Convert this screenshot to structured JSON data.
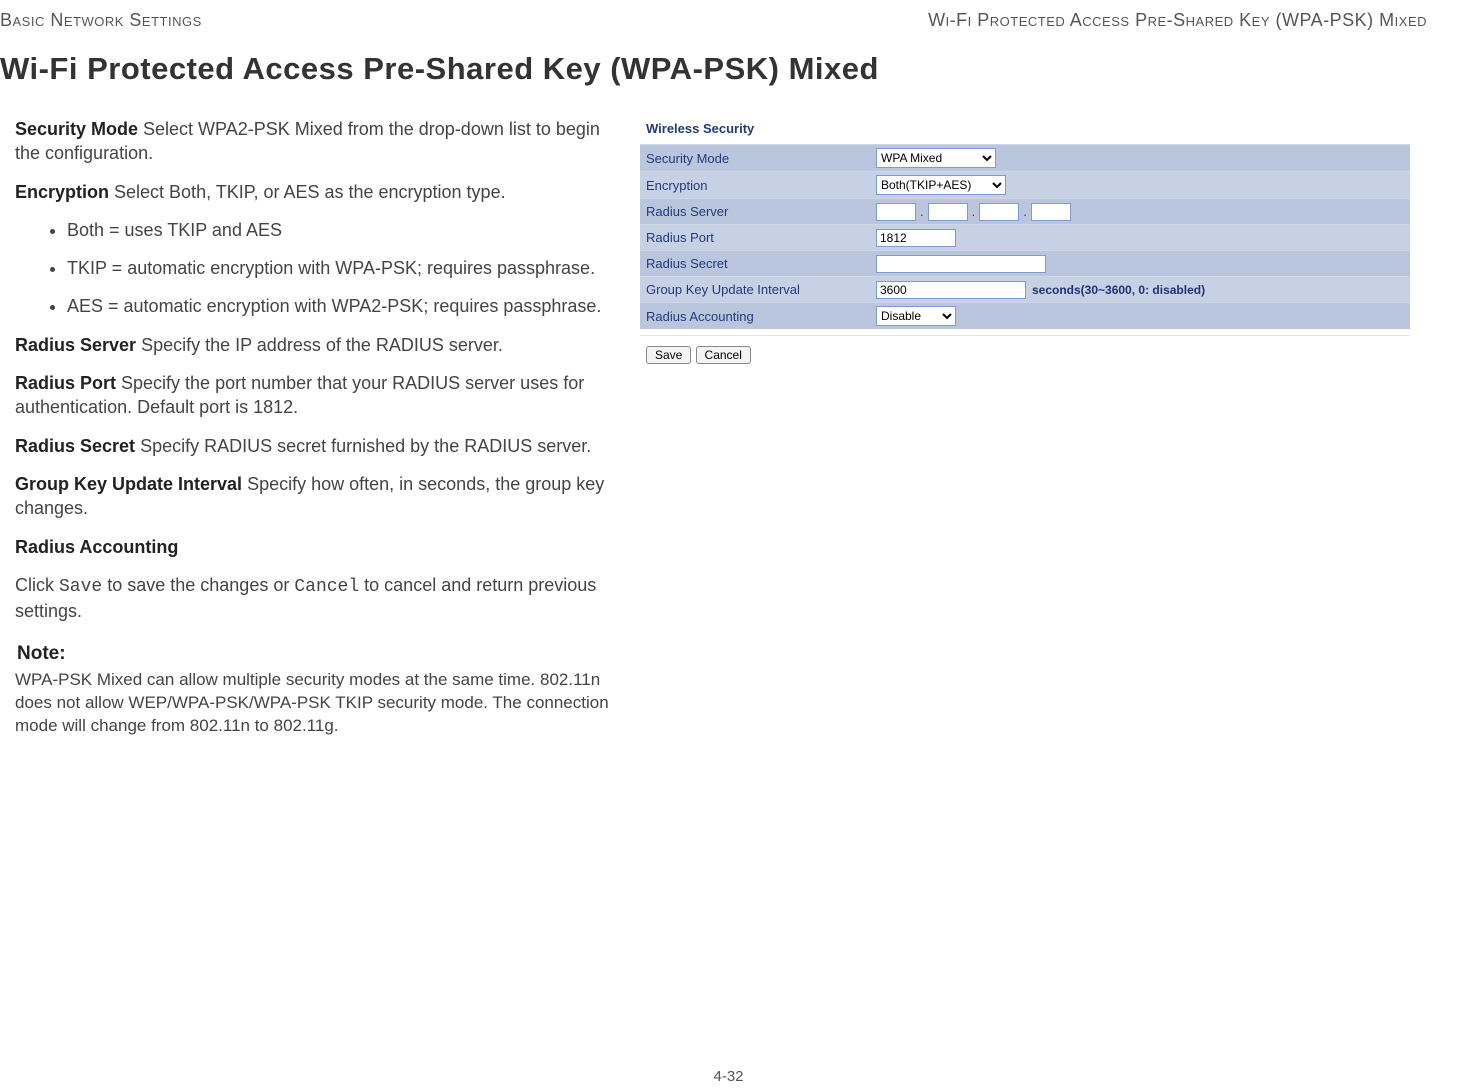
{
  "header": {
    "left": "Basic Network Settings",
    "right": "Wi-Fi Protected Access Pre-Shared Key (WPA-PSK) Mixed"
  },
  "heading": "Wi-Fi Protected Access Pre-Shared Key (WPA-PSK) Mixed",
  "body": {
    "security_mode_label": "Security Mode",
    "security_mode_text": "  Select WPA2-PSK Mixed from the drop-down list to begin the configuration.",
    "encryption_label": "Encryption",
    "encryption_text": "  Select Both, TKIP, or AES as the encryption type.",
    "bullets": [
      "Both = uses TKIP and AES",
      "TKIP = automatic encryption with WPA-PSK; requires passphrase.",
      "AES = automatic encryption with WPA2-PSK; requires passphrase."
    ],
    "radius_server_label": "Radius Server",
    "radius_server_text": "  Specify the IP address of the RADIUS server.",
    "radius_port_label": "Radius Port",
    "radius_port_text": "  Specify the port number that your RADIUS server uses for authentication. Default port is 1812.",
    "radius_secret_label": "Radius Secret",
    "radius_secret_text": "  Specify RADIUS secret furnished by the RADIUS server.",
    "gkui_label": "Group Key Update Interval",
    "gkui_text": "  Specify how often, in seconds, the group key changes.",
    "radius_accounting_label": "Radius Accounting",
    "click_prefix": "Click ",
    "save_word": "Save",
    "click_mid": " to save the changes or ",
    "cancel_word": "Cancel",
    "click_suffix": " to cancel and return previous settings.",
    "note_heading": "Note:",
    "note_body": "WPA-PSK Mixed can allow multiple security modes at the same time. 802.11n does not allow WEP/WPA-PSK/WPA-PSK TKIP security mode. The connection mode will change from 802.11n to 802.11g."
  },
  "panel": {
    "title": "Wireless Security",
    "rows": {
      "security_mode": "Security Mode",
      "encryption": "Encryption",
      "radius_server": "Radius Server",
      "radius_port": "Radius Port",
      "radius_secret": "Radius Secret",
      "gkui": "Group Key Update Interval",
      "radius_accounting": "Radius Accounting"
    },
    "values": {
      "security_mode_selected": "WPA Mixed",
      "encryption_selected": "Both(TKIP+AES)",
      "radius_ip": [
        "",
        "",
        "",
        ""
      ],
      "radius_port": "1812",
      "radius_secret": "",
      "gkui": "3600",
      "gkui_hint": "seconds(30~3600, 0: disabled)",
      "radius_accounting_selected": "Disable"
    },
    "buttons": {
      "save": "Save",
      "cancel": "Cancel"
    }
  },
  "footer": "4-32"
}
